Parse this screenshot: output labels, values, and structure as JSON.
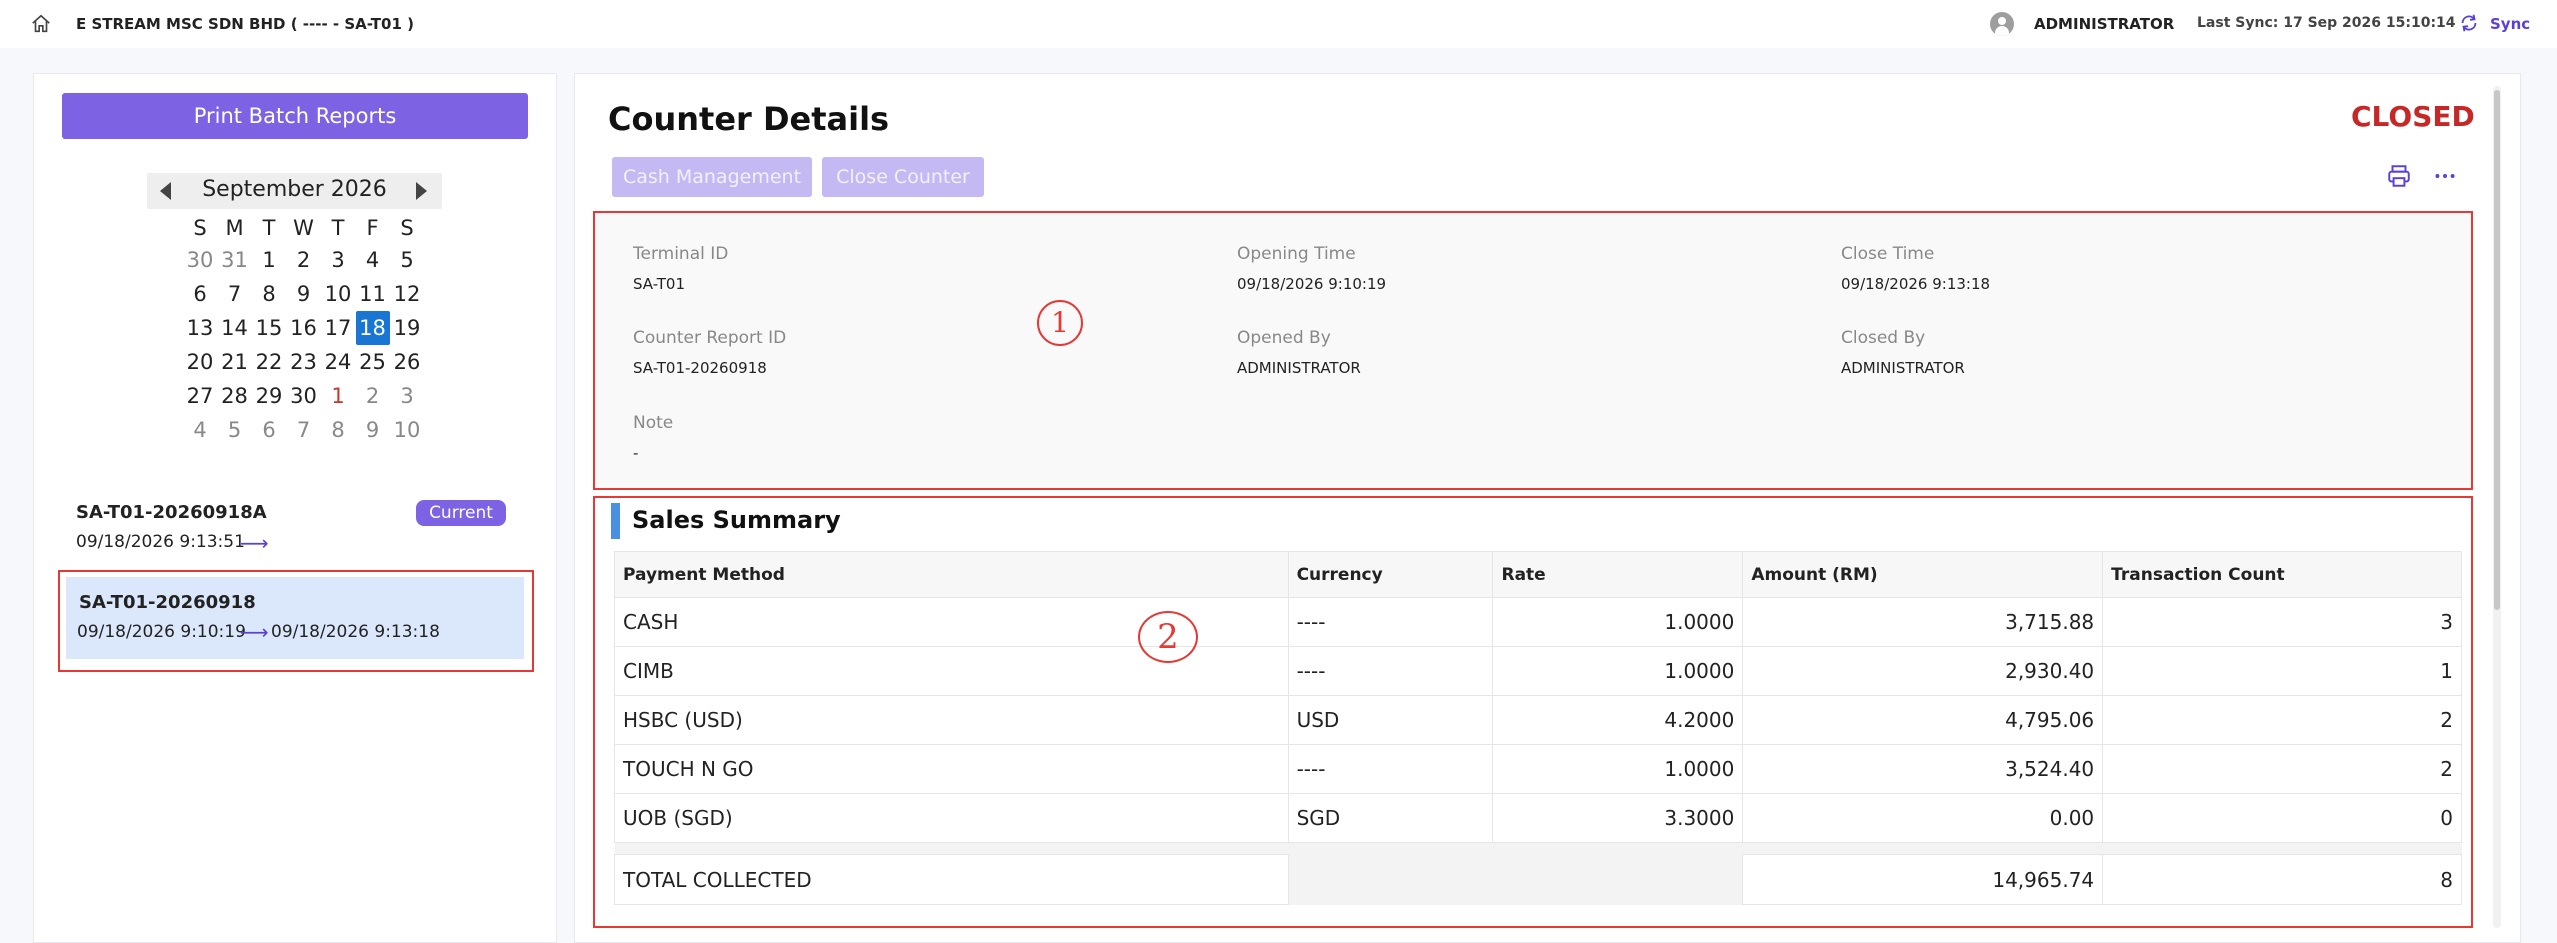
{
  "topbar": {
    "company": "E STREAM MSC SDN BHD ( ---- - SA-T01 )",
    "user": "ADMINISTRATOR",
    "last_sync": "Last Sync: 17 Sep 2026 15:10:14",
    "sync_label": "Sync",
    "icons": {
      "home": "home-icon",
      "avatar": "user-avatar-icon",
      "sync": "sync-icon"
    }
  },
  "sidebar": {
    "print_button": "Print Batch Reports",
    "calendar": {
      "month_label": "September 2026",
      "weekdays": [
        "S",
        "M",
        "T",
        "W",
        "T",
        "F",
        "S"
      ],
      "weeks": [
        [
          "30",
          "31",
          "1",
          "2",
          "3",
          "4",
          "5"
        ],
        [
          "6",
          "7",
          "8",
          "9",
          "10",
          "11",
          "12"
        ],
        [
          "13",
          "14",
          "15",
          "16",
          "17",
          "18",
          "19"
        ],
        [
          "20",
          "21",
          "22",
          "23",
          "24",
          "25",
          "26"
        ],
        [
          "27",
          "28",
          "29",
          "30",
          "1",
          "2",
          "3"
        ],
        [
          "4",
          "5",
          "6",
          "7",
          "8",
          "9",
          "10"
        ]
      ],
      "selected": "18"
    },
    "batches": [
      {
        "id": "SA-T01-20260918A",
        "badge": "Current",
        "start": "09/18/2026 9:13:51",
        "arrow": "⟶"
      },
      {
        "id": "SA-T01-20260918",
        "start": "09/18/2026 9:10:19",
        "arrow": "⟶",
        "end": "09/18/2026 9:13:18"
      }
    ]
  },
  "main": {
    "title": "Counter Details",
    "status": "CLOSED",
    "status_color": "#c62828",
    "buttons": {
      "cash_management": "Cash Management",
      "close_counter": "Close Counter"
    },
    "icons": {
      "print": "print-icon",
      "more": "more-icon"
    },
    "details": {
      "terminal_id_label": "Terminal ID",
      "terminal_id": "SA-T01",
      "opening_time_label": "Opening Time",
      "opening_time": "09/18/2026 9:10:19",
      "close_time_label": "Close Time",
      "close_time": "09/18/2026 9:13:18",
      "report_id_label": "Counter Report ID",
      "report_id": "SA-T01-20260918",
      "opened_by_label": "Opened By",
      "opened_by": "ADMINISTRATOR",
      "closed_by_label": "Closed By",
      "closed_by": "ADMINISTRATOR",
      "note_label": "Note",
      "note": "-"
    },
    "annotation_1": "1",
    "annotation_2": "2",
    "sales": {
      "title": "Sales Summary",
      "columns": [
        "Payment Method",
        "Currency",
        "Rate",
        "Amount (RM)",
        "Transaction Count"
      ],
      "rows": [
        [
          "CASH",
          "----",
          "1.0000",
          "3,715.88",
          "3"
        ],
        [
          "CIMB",
          "----",
          "1.0000",
          "2,930.40",
          "1"
        ],
        [
          "HSBC (USD)",
          "USD",
          "4.2000",
          "4,795.06",
          "2"
        ],
        [
          "TOUCH N GO",
          "----",
          "1.0000",
          "3,524.40",
          "2"
        ],
        [
          "UOB (SGD)",
          "SGD",
          "3.3000",
          "0.00",
          "0"
        ]
      ],
      "total": {
        "label": "TOTAL COLLECTED",
        "amount": "14,965.74",
        "count": "8"
      }
    }
  }
}
